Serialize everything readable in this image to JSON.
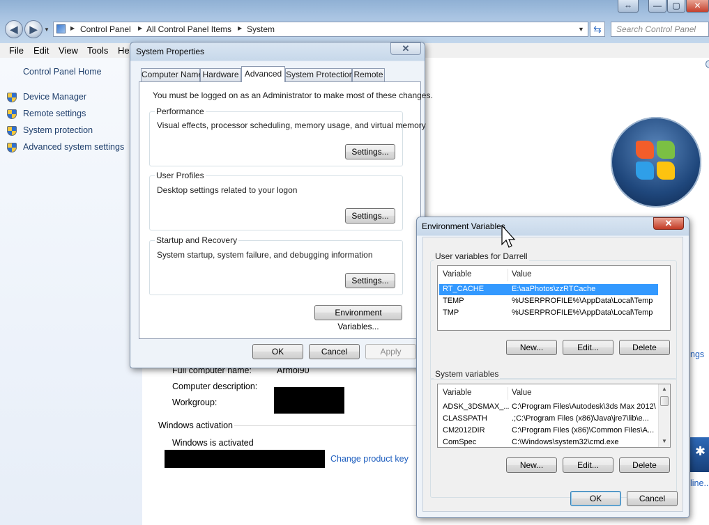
{
  "window": {
    "caption_buttons": {
      "restore": "⇔",
      "minimize": "—",
      "maximize": "▢",
      "close": "✕"
    },
    "nav": {
      "back_icon": "back-arrow-icon",
      "forward_icon": "forward-arrow-icon"
    },
    "breadcrumb": [
      "Control Panel",
      "All Control Panel Items",
      "System"
    ],
    "search_placeholder": "Search Control Panel"
  },
  "menu": [
    "File",
    "Edit",
    "View",
    "Tools",
    "He"
  ],
  "left_nav": {
    "home": "Control Panel Home",
    "links": [
      "Device Manager",
      "Remote settings",
      "System protection",
      "Advanced system settings"
    ]
  },
  "content": {
    "full_computer_name_label": "Full computer name:",
    "full_computer_name_value": "Armol90",
    "computer_description_label": "Computer description:",
    "workgroup_label": "Workgroup:",
    "activation_heading": "Windows activation",
    "activation_status": "Windows is activated",
    "change_key_link": "Change product key",
    "right_fragment_1": "ngs",
    "right_fragment_2": "line.."
  },
  "system_properties": {
    "title": "System Properties",
    "tabs": [
      "Computer Name",
      "Hardware",
      "Advanced",
      "System Protection",
      "Remote"
    ],
    "active_tab": "Advanced",
    "admin_note": "You must be logged on as an Administrator to make most of these changes.",
    "groups": [
      {
        "label": "Performance",
        "description": "Visual effects, processor scheduling, memory usage, and virtual memory",
        "button": "Settings..."
      },
      {
        "label": "User Profiles",
        "description": "Desktop settings related to your logon",
        "button": "Settings..."
      },
      {
        "label": "Startup and Recovery",
        "description": "System startup, system failure, and debugging information",
        "button": "Settings..."
      }
    ],
    "env_button": "Environment Variables...",
    "ok": "OK",
    "cancel": "Cancel",
    "apply": "Apply"
  },
  "env_vars": {
    "title": "Environment Variables",
    "user_section": "User variables for Darrell",
    "columns": [
      "Variable",
      "Value"
    ],
    "user_rows": [
      {
        "variable": "RT_CACHE",
        "value": "E:\\aaPhotos\\zzRTCache",
        "selected": true
      },
      {
        "variable": "TEMP",
        "value": "%USERPROFILE%\\AppData\\Local\\Temp",
        "selected": false
      },
      {
        "variable": "TMP",
        "value": "%USERPROFILE%\\AppData\\Local\\Temp",
        "selected": false
      }
    ],
    "user_buttons": [
      "New...",
      "Edit...",
      "Delete"
    ],
    "system_section": "System variables",
    "system_rows": [
      {
        "variable": "ADSK_3DSMAX_...",
        "value": "C:\\Program Files\\Autodesk\\3ds Max 2012\\"
      },
      {
        "variable": "CLASSPATH",
        "value": ".;C:\\Program Files (x86)\\Java\\jre7\\lib\\e..."
      },
      {
        "variable": "CM2012DIR",
        "value": "C:\\Program Files (x86)\\Common Files\\A..."
      },
      {
        "variable": "ComSpec",
        "value": "C:\\Windows\\system32\\cmd.exe"
      }
    ],
    "system_buttons": [
      "New...",
      "Edit...",
      "Delete"
    ],
    "ok": "OK",
    "cancel": "Cancel"
  }
}
